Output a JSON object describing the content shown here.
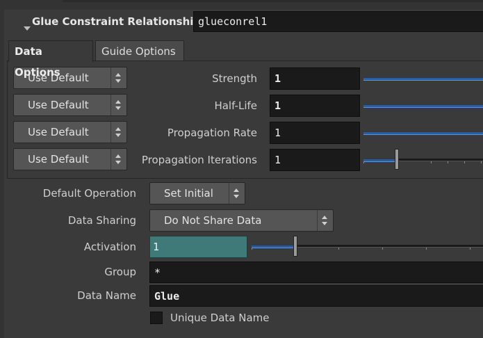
{
  "header": {
    "label": "Glue Constraint Relationship",
    "name_value": "glueconrel1"
  },
  "tabs": [
    {
      "label": "Data Options",
      "active": true
    },
    {
      "label": "Guide Options",
      "active": false
    }
  ],
  "data_options": {
    "rows": [
      {
        "menu": "Use Default",
        "label": "Strength",
        "value": "1",
        "bold": true
      },
      {
        "menu": "Use Default",
        "label": "Half-Life",
        "value": "1",
        "bold": true
      },
      {
        "menu": "Use Default",
        "label": "Propagation Rate",
        "value": "1",
        "bold": false
      },
      {
        "menu": "Use Default",
        "label": "Propagation Iterations",
        "value": "1",
        "bold": false
      }
    ]
  },
  "params": {
    "default_operation": {
      "label": "Default Operation",
      "value": "Set Initial"
    },
    "data_sharing": {
      "label": "Data Sharing",
      "value": "Do Not Share Data"
    },
    "activation": {
      "label": "Activation",
      "value": "1"
    },
    "group": {
      "label": "Group",
      "value": "*"
    },
    "data_name": {
      "label": "Data Name",
      "value": "Glue"
    },
    "unique_data_name": {
      "label": "Unique Data Name",
      "checked": false
    }
  },
  "colors": {
    "background": "#3a3a3a",
    "field": "#1a1a1a",
    "slider_active": "#2b5c9e",
    "activation_field": "#3f7a78"
  }
}
